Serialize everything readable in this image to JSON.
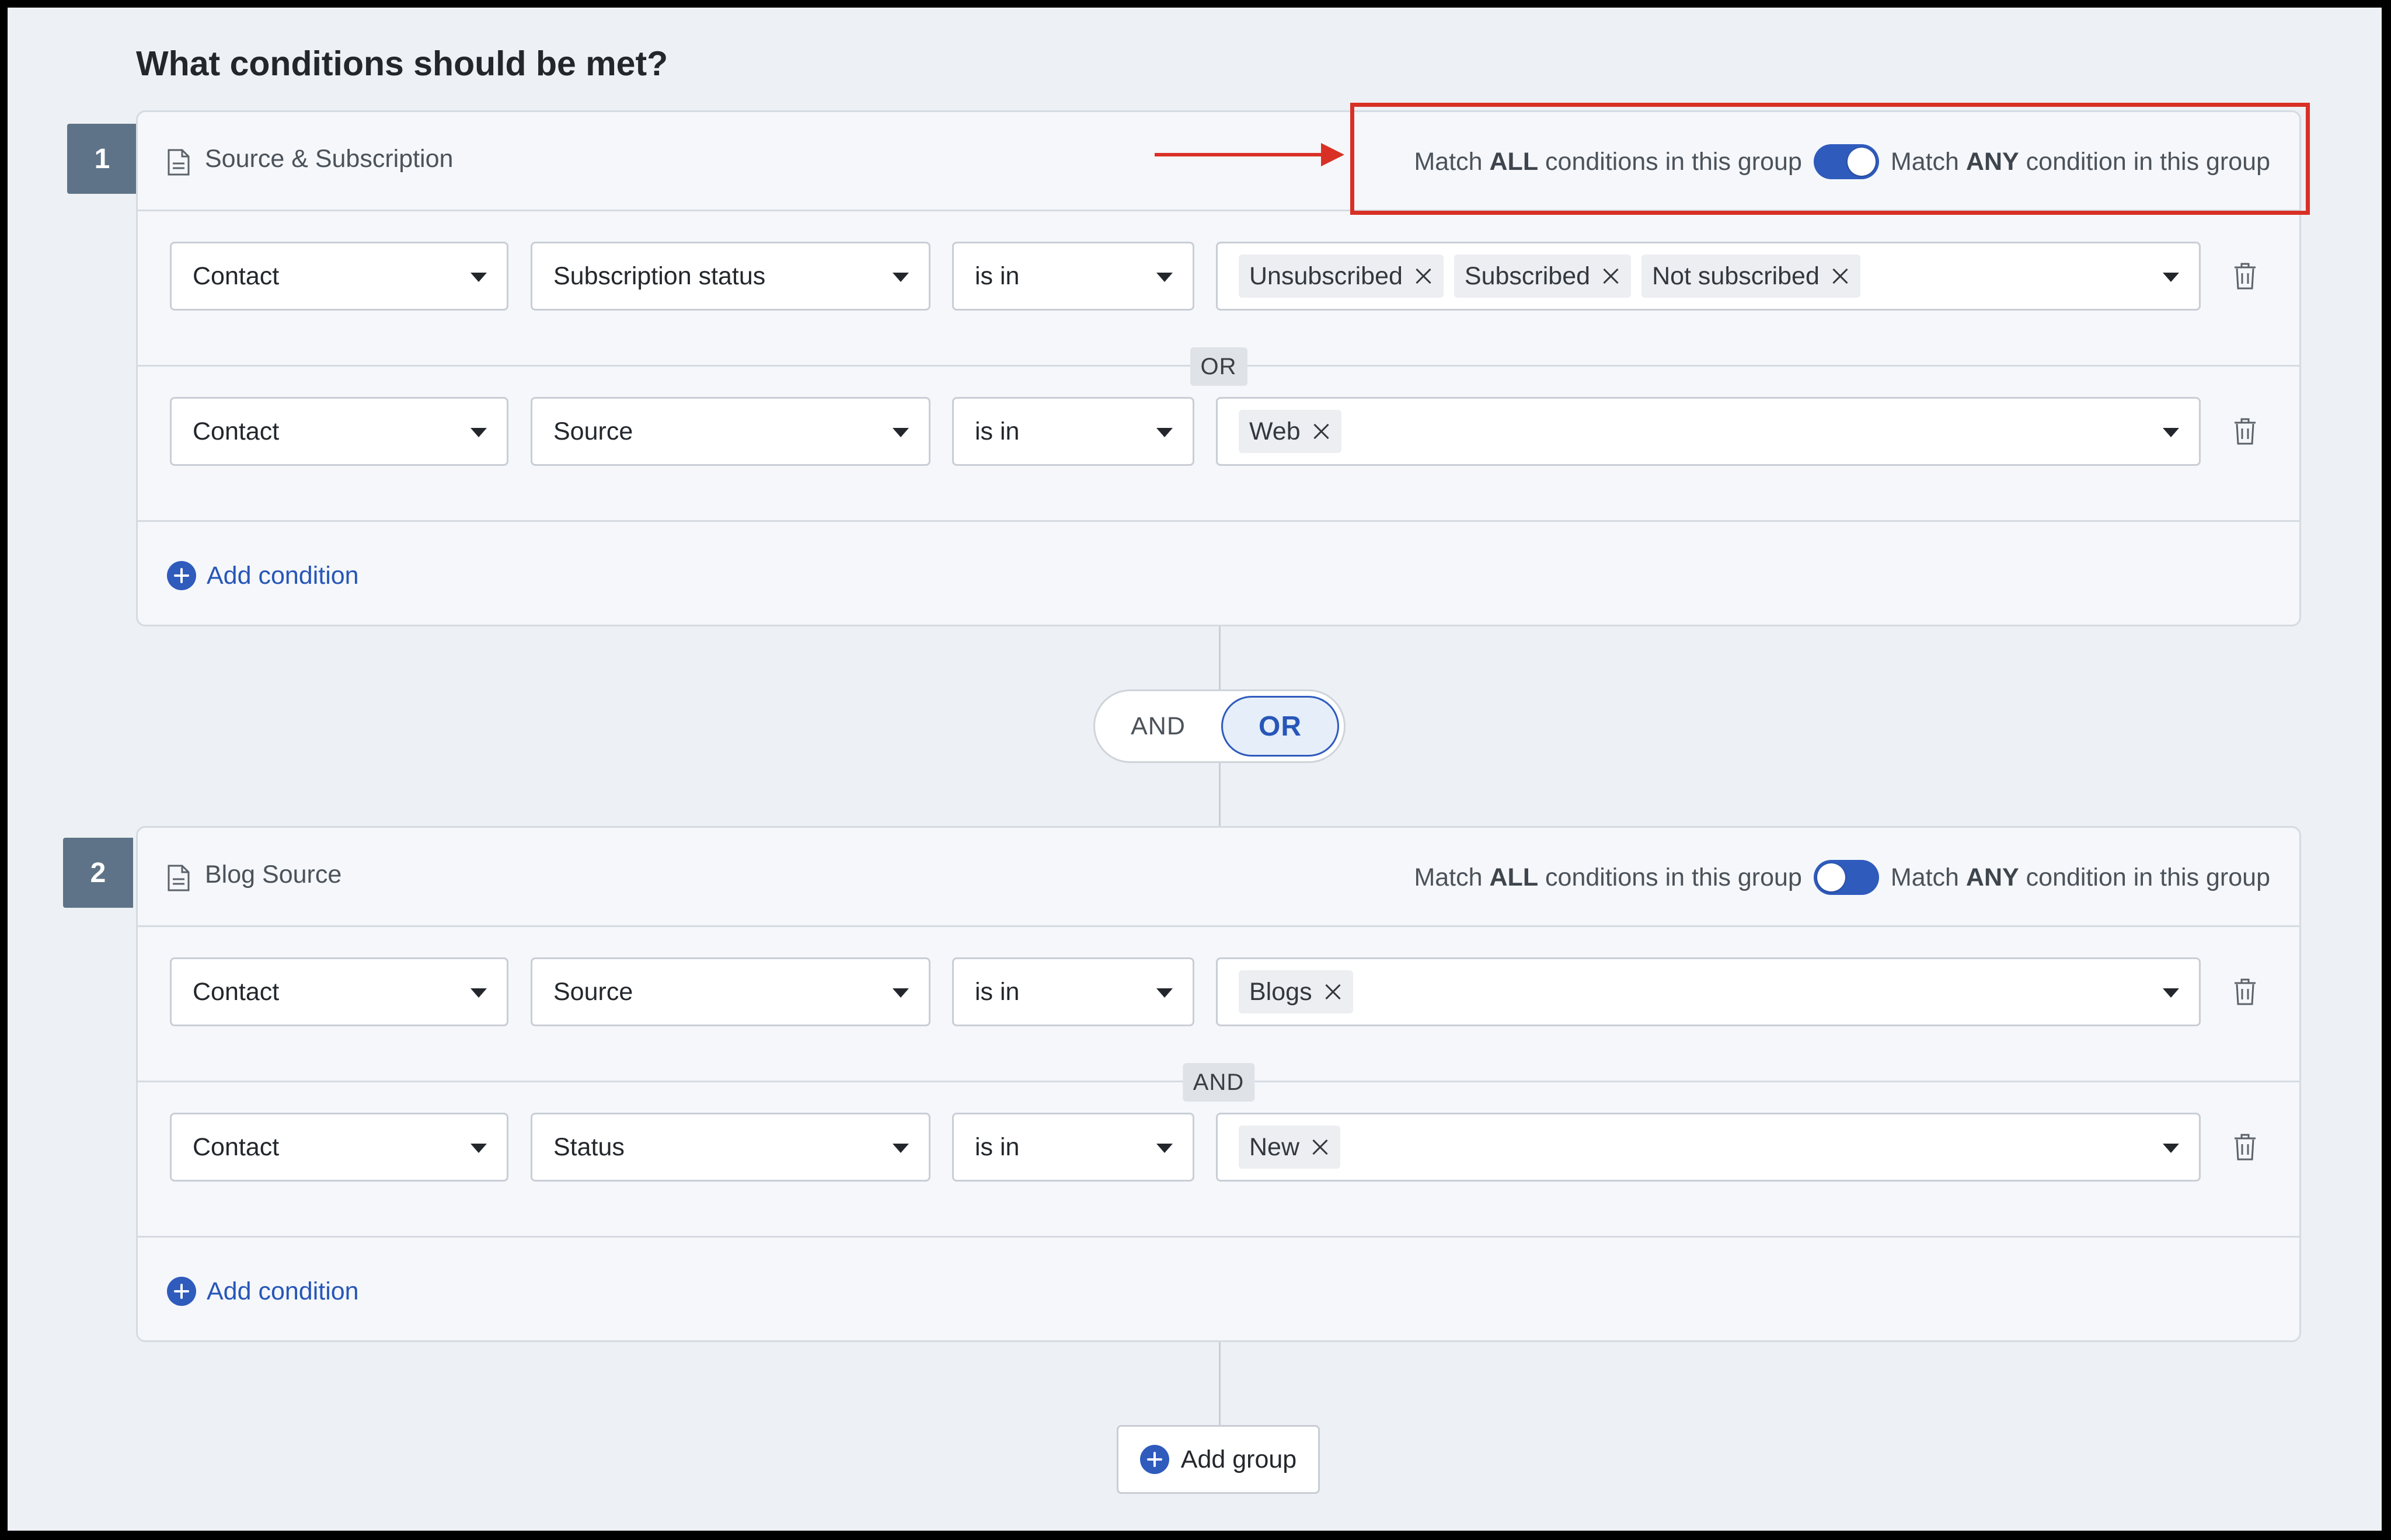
{
  "page": {
    "title": "What conditions should be met?"
  },
  "groups": [
    {
      "number": "1",
      "name": "Source & Subscription",
      "match_prefix": "Match ",
      "match_all_bold": "ALL",
      "match_all_suffix": " conditions in this group",
      "match_any_bold": "ANY",
      "match_any_suffix": " condition in this group",
      "toggle_state": "any",
      "conditions": [
        {
          "entity": "Contact",
          "field": "Subscription status",
          "operator": "is in",
          "values": [
            "Unsubscribed",
            "Subscribed",
            "Not subscribed"
          ]
        },
        {
          "entity": "Contact",
          "field": "Source",
          "operator": "is in",
          "values": [
            "Web"
          ]
        }
      ],
      "connector": "OR",
      "add_condition_label": "Add condition"
    },
    {
      "number": "2",
      "name": "Blog Source",
      "match_prefix": "Match ",
      "match_all_bold": "ALL",
      "match_all_suffix": " conditions in this group",
      "match_any_bold": "ANY",
      "match_any_suffix": " condition in this group",
      "toggle_state": "all",
      "conditions": [
        {
          "entity": "Contact",
          "field": "Source",
          "operator": "is in",
          "values": [
            "Blogs"
          ]
        },
        {
          "entity": "Contact",
          "field": "Status",
          "operator": "is in",
          "values": [
            "New"
          ]
        }
      ],
      "connector": "AND",
      "add_condition_label": "Add condition"
    }
  ],
  "group_join": {
    "and_label": "AND",
    "or_label": "OR",
    "selected": "OR"
  },
  "add_group_label": "Add group",
  "colors": {
    "accent": "#2f5bbd",
    "highlight": "#d93025",
    "group_number_bg": "#5e7387"
  }
}
